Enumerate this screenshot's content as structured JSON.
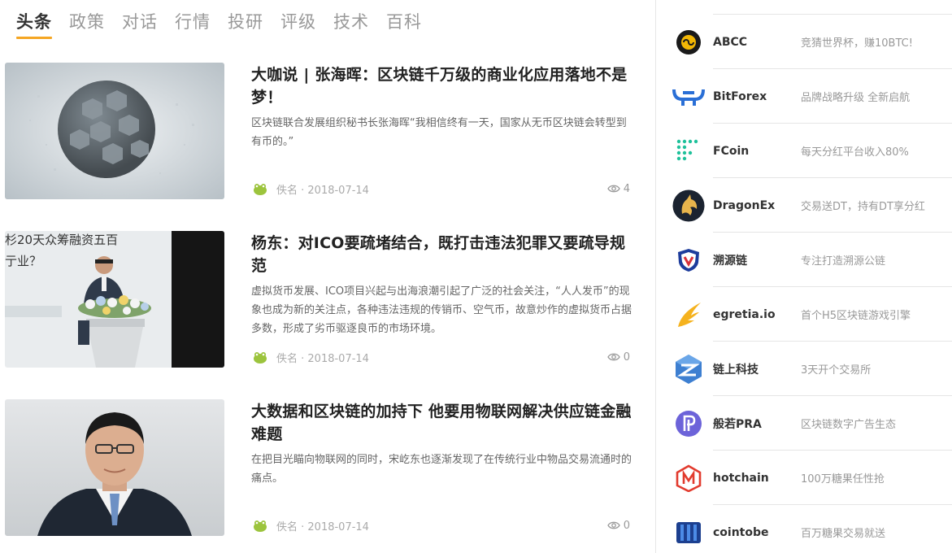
{
  "tabs": [
    {
      "label": "头条",
      "active": true
    },
    {
      "label": "政策"
    },
    {
      "label": "对话"
    },
    {
      "label": "行情"
    },
    {
      "label": "投研"
    },
    {
      "label": "评级"
    },
    {
      "label": "技术"
    },
    {
      "label": "百科"
    }
  ],
  "articles": [
    {
      "title": "大咖说 | 张海晖：区块链千万级的商业化应用落地不是梦！",
      "desc": "区块链联合发展组织秘书长张海晖“我相信终有一天，国家从无币区块链会转型到有币的。”",
      "author": "佚名 · 2018-07-14",
      "views": "4",
      "thumb_text": ""
    },
    {
      "title": "杨东：对ICO要疏堵结合，既打击违法犯罪又要疏导规范",
      "desc": "虚拟货币发展、ICO项目兴起与出海浪潮引起了广泛的社会关注，“人人发币”的现象也成为新的关注点，各种违法违规的传销币、空气币，故意炒作的虚拟货币占据多数，形成了劣币驱逐良币的市场环境。",
      "author": "佚名 · 2018-07-14",
      "views": "0",
      "thumb_text": "杉20天众筹融资五百",
      "thumb_text2": "亍业？"
    },
    {
      "title": "大数据和区块链的加持下 他要用物联网解决供应链金融难题",
      "desc": "在把目光瞄向物联网的同时，宋屹东也逐渐发现了在传统行业中物品交易流通时的痛点。",
      "author": "佚名 · 2018-07-14",
      "views": "0"
    }
  ],
  "exchanges": [
    {
      "name": "ABCC",
      "slogan": "竞猜世界杯，赚10BTC!",
      "icon": "abcc-logo-icon"
    },
    {
      "name": "BitForex",
      "slogan": "品牌战略升级 全新启航",
      "icon": "bitforex-logo-icon"
    },
    {
      "name": "FCoin",
      "slogan": "每天分红平台收入80%",
      "icon": "fcoin-logo-icon"
    },
    {
      "name": "DragonEx",
      "slogan": "交易送DT，持有DT享分红",
      "icon": "dragonex-logo-icon"
    },
    {
      "name": "溯源链",
      "slogan": "专注打造溯源公链",
      "icon": "suyuanlian-logo-icon"
    },
    {
      "name": "egretia.io",
      "slogan": "首个H5区块链游戏引擎",
      "icon": "egretia-logo-icon"
    },
    {
      "name": "链上科技",
      "slogan": "3天开个交易所",
      "icon": "lianshang-logo-icon"
    },
    {
      "name": "般若PRA",
      "slogan": "区块链数字广告生态",
      "icon": "pra-logo-icon"
    },
    {
      "name": "hotchain",
      "slogan": "100万糖果任性抢",
      "icon": "hotchain-logo-icon"
    },
    {
      "name": "cointobe",
      "slogan": "百万糖果交易就送",
      "icon": "cointobe-logo-icon"
    }
  ],
  "colors": {
    "accent": "#f5a623"
  }
}
